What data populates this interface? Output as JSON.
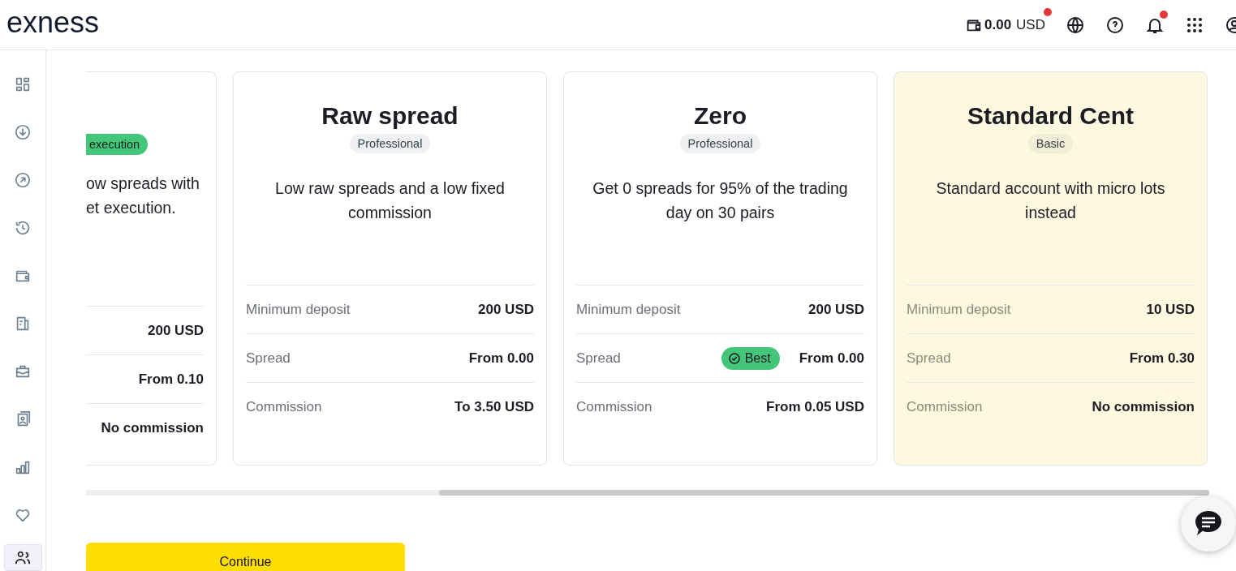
{
  "header": {
    "logo": "exness",
    "balance": {
      "amount": "0.00",
      "currency": "USD",
      "dot": true
    },
    "bell_dot": true
  },
  "sidebar": {
    "items": [
      {
        "selected": false
      },
      {
        "selected": false
      },
      {
        "selected": false
      },
      {
        "selected": false
      },
      {
        "selected": false
      },
      {
        "selected": false
      },
      {
        "selected": false
      },
      {
        "selected": false
      },
      {
        "selected": false
      },
      {
        "selected": false
      },
      {
        "selected": true
      }
    ]
  },
  "partial_card": {
    "tag": "execution",
    "lines": [
      "ow spreads with",
      "et execution."
    ],
    "values": [
      "200 USD",
      "From 0.10",
      "No commission"
    ]
  },
  "cards": [
    {
      "title": "Raw spread",
      "level_tag": "Professional",
      "description": "Low raw spreads and a low fixed commission",
      "selected": false,
      "rows": [
        {
          "label": "Minimum deposit",
          "value": "200 USD"
        },
        {
          "label": "Spread",
          "value": "From 0.00"
        },
        {
          "label": "Commission",
          "value": "To 3.50 USD"
        }
      ]
    },
    {
      "title": "Zero",
      "level_tag": "Professional",
      "description": "Get 0 spreads for 95% of the trading day on 30 pairs",
      "selected": false,
      "rows": [
        {
          "label": "Minimum deposit",
          "value": "200 USD"
        },
        {
          "label": "Spread",
          "value": "From 0.00",
          "badge": "Best"
        },
        {
          "label": "Commission",
          "value": "From 0.05 USD"
        }
      ]
    },
    {
      "title": "Standard Cent",
      "level_tag": "Basic",
      "description": "Standard account with micro lots instead",
      "selected": true,
      "rows": [
        {
          "label": "Minimum deposit",
          "value": "10 USD"
        },
        {
          "label": "Spread",
          "value": "From 0.30"
        },
        {
          "label": "Commission",
          "value": "No commission"
        }
      ]
    }
  ],
  "continue_button": "Continue"
}
